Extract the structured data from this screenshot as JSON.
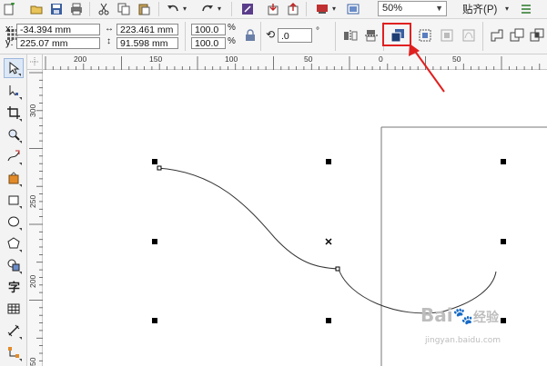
{
  "toolbar": {
    "zoom_value": "50%",
    "snap_label": "贴齐(P)"
  },
  "property_bar": {
    "x_label": "x:",
    "x_value": "-34.394 mm",
    "y_label": "y:",
    "y_value": "225.07 mm",
    "width_value": "223.461 mm",
    "height_value": "91.598 mm",
    "scale_x_value": "100.0",
    "scale_y_value": "100.0",
    "percent_symbol": "%",
    "rotation_value": ".0",
    "degree_symbol": "°"
  },
  "rulers": {
    "horizontal_labels": [
      "200",
      "150",
      "100",
      "50",
      "0",
      "50"
    ],
    "vertical_labels": [
      "300",
      "250",
      "200",
      "50"
    ]
  },
  "watermark": {
    "brand": "Bai",
    "brand_suffix": "经验",
    "url": "jingyan.baidu.com"
  },
  "colors": {
    "highlight": "#e02020",
    "accent_arrow": "#e02020",
    "selection_handle": "#000000",
    "curve": "#333333"
  },
  "icons": {
    "highlighted_button": "back-minus-front-icon"
  }
}
